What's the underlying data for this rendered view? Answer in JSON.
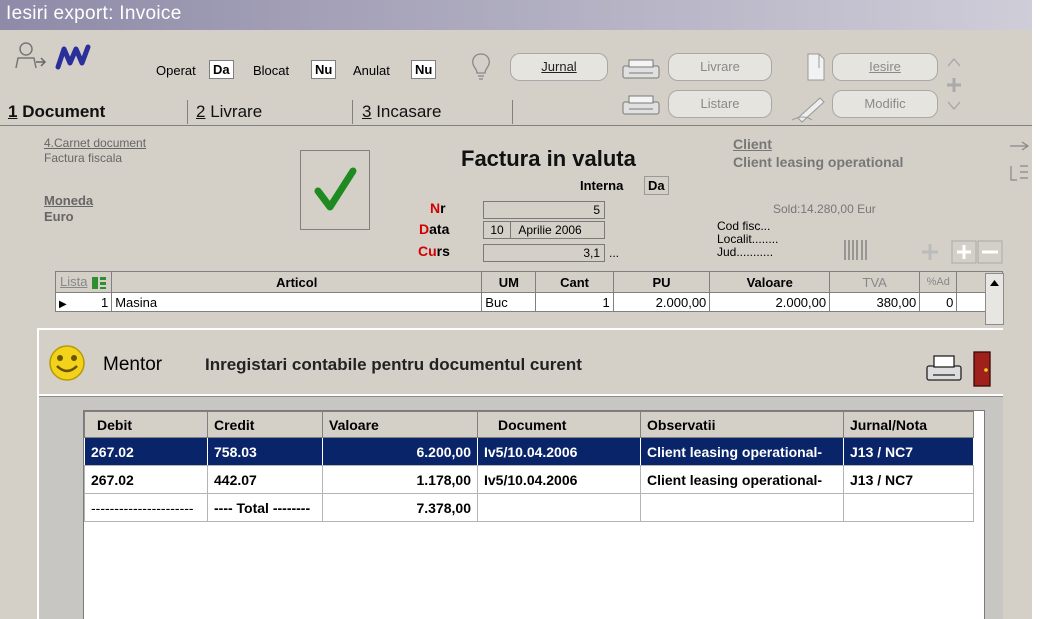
{
  "window": {
    "title": "Iesiri export: Invoice"
  },
  "toolbar": {
    "operat_label": "Operat",
    "operat_value": "Da",
    "blocat_label": "Blocat",
    "blocat_value": "Nu",
    "anulat_label": "Anulat",
    "anulat_value": "Nu",
    "jurnal": "Jurnal",
    "livrare": "Livrare",
    "iesire": "Iesire",
    "listare": "Listare",
    "modific": "Modific"
  },
  "tabs": [
    {
      "num": "1",
      "label": "Document"
    },
    {
      "num": "2",
      "label": "Livrare"
    },
    {
      "num": "3",
      "label": "Incasare"
    }
  ],
  "document": {
    "carnet_label": "4.Carnet document",
    "carnet_value": "Factura fiscala",
    "moneda_label": "Moneda",
    "moneda_value": "Euro",
    "title": "Factura in valuta",
    "interna_label": "Interna",
    "interna_value": "Da",
    "nr_label": "Nr",
    "nr_value": "5",
    "data_label": "Data",
    "data_day": "10",
    "data_value": "Aprilie 2006",
    "curs_label": "Curs",
    "curs_value": "3,1",
    "curs_dots": "...",
    "client_label": "Client",
    "client_value": "Client leasing operational",
    "sold": "Sold:14.280,00 Eur",
    "cod_fisc": "Cod fisc...",
    "localit": "Localit........",
    "jud": "Jud..........."
  },
  "articles": {
    "headers": [
      "Lista",
      "Articol",
      "UM",
      "Cant",
      "PU",
      "Valoare",
      "TVA",
      "%Ad"
    ],
    "rows": [
      {
        "nr": "1",
        "articol": "Masina",
        "um": "Buc",
        "cant": "1",
        "pu": "2.000,00",
        "valoare": "2.000,00",
        "tva": "380,00",
        "ad": "0"
      }
    ]
  },
  "mentor": {
    "name": "Mentor",
    "title": "Inregistari contabile pentru documentul curent",
    "headers": [
      "Debit",
      "Credit",
      "Valoare",
      "Document",
      "Observatii",
      "Jurnal/Nota"
    ],
    "rows": [
      {
        "debit": "267.02",
        "credit": "758.03",
        "valoare": "6.200,00",
        "document": "Iv5/10.04.2006",
        "observatii": "Client leasing operational-",
        "jurnal": "J13 / NC7"
      },
      {
        "debit": "267.02",
        "credit": "442.07",
        "valoare": "1.178,00",
        "document": "Iv5/10.04.2006",
        "observatii": "Client leasing operational-",
        "jurnal": "J13 / NC7"
      },
      {
        "debit": "----------------------",
        "credit": "---- Total --------",
        "valoare": "7.378,00",
        "document": "",
        "observatii": "",
        "jurnal": ""
      }
    ]
  },
  "colors": {
    "titlebar": "#8e8aa8",
    "selection": "#0a246a",
    "red_label": "#d40000"
  },
  "icons": [
    "user-transfer-icon",
    "m-logo-icon",
    "lightbulb-icon",
    "printer-icon",
    "document-icon",
    "up-arrow-icon",
    "cross-icon",
    "down-arrow-icon",
    "pen-icon",
    "checkmark-icon",
    "smiley-icon",
    "exit-door-icon"
  ]
}
